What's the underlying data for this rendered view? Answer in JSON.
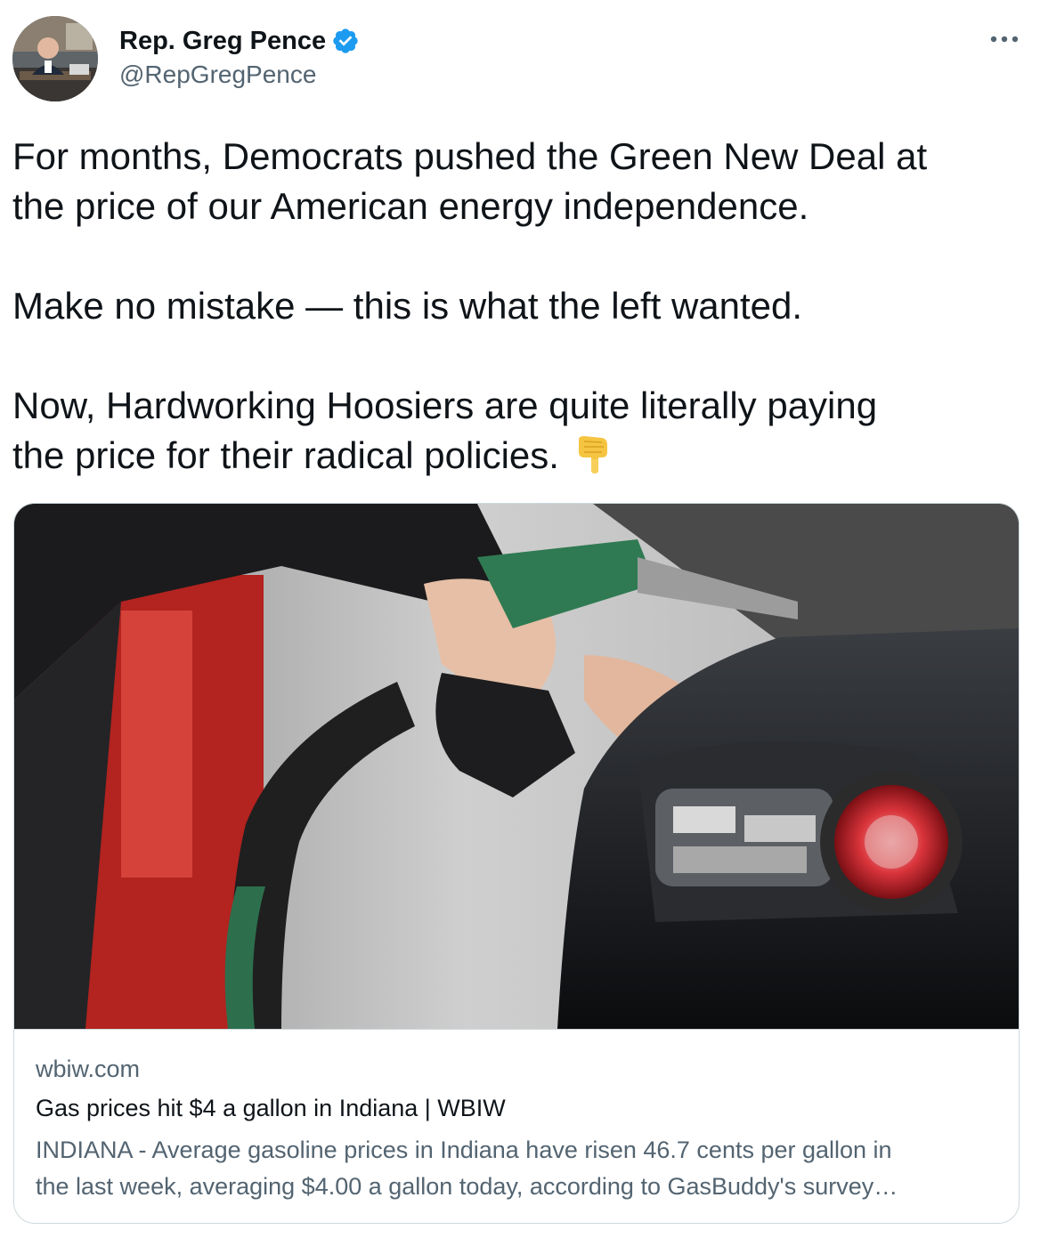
{
  "author": {
    "display_name": "Rep. Greg Pence",
    "handle": "@RepGregPence",
    "verified": true,
    "verified_color": "#1d9bf0",
    "avatar_icon": "avatar-photo"
  },
  "menu": {
    "icon": "more-horizontal-icon",
    "glyph": "•••"
  },
  "tweet": {
    "paragraphs": [
      [
        "For months, Democrats pushed the Green New Deal at",
        "the price of our American energy independence."
      ],
      [
        "Make no mistake — this is what the left wanted."
      ],
      [
        "Now, Hardworking Hoosiers are quite literally paying",
        "the price for their radical policies."
      ]
    ],
    "emoji": "backhand-index-pointing-down-emoji"
  },
  "card": {
    "image_icon": "gas-pump-photo",
    "domain": "wbiw.com",
    "title": "Gas prices hit $4 a gallon in Indiana | WBIW",
    "description_lines": [
      "INDIANA - Average gasoline prices in Indiana have risen 46.7 cents per gallon in",
      "the last week, averaging $4.00 a gallon today, according to GasBuddy's survey…"
    ]
  },
  "colors": {
    "text_primary": "#0f1419",
    "text_secondary": "#536471",
    "border": "#cfd9de"
  }
}
